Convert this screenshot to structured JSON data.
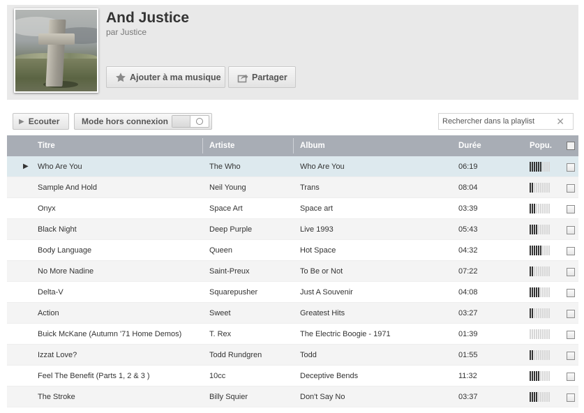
{
  "album": {
    "title": "And Justice",
    "artist": "par Justice",
    "add_label": "Ajouter à ma musique",
    "add_icon": "star-icon",
    "share_label": "Partager",
    "share_icon": "share-icon"
  },
  "toolbar": {
    "listen_label": "Ecouter",
    "offline_label": "Mode hors connexion",
    "offline_enabled": false,
    "search_placeholder": "Rechercher dans la playlist"
  },
  "table": {
    "columns": {
      "title": "Titre",
      "artist": "Artiste",
      "album": "Album",
      "duration": "Durée",
      "popularity": "Popu."
    },
    "popularity_max": 10,
    "rows": [
      {
        "title": "Who Are You",
        "artist": "The Who",
        "album": "Who Are You",
        "duration": "06:19",
        "popularity": 6,
        "playing": true
      },
      {
        "title": "Sample And Hold",
        "artist": "Neil Young",
        "album": "Trans",
        "duration": "08:04",
        "popularity": 2
      },
      {
        "title": "Onyx",
        "artist": "Space Art",
        "album": "Space art",
        "duration": "03:39",
        "popularity": 3
      },
      {
        "title": "Black Night",
        "artist": "Deep Purple",
        "album": "Live 1993",
        "duration": "05:43",
        "popularity": 4
      },
      {
        "title": "Body Language",
        "artist": "Queen",
        "album": "Hot Space",
        "duration": "04:32",
        "popularity": 6
      },
      {
        "title": "No More Nadine",
        "artist": "Saint-Preux",
        "album": "To Be or Not",
        "duration": "07:22",
        "popularity": 2
      },
      {
        "title": "Delta-V",
        "artist": "Squarepusher",
        "album": "Just A Souvenir",
        "duration": "04:08",
        "popularity": 5
      },
      {
        "title": "Action",
        "artist": "Sweet",
        "album": "Greatest Hits",
        "duration": "03:27",
        "popularity": 2
      },
      {
        "title": "Buick McKane (Autumn '71 Home Demos)",
        "artist": "T. Rex",
        "album": "The Electric Boogie - 1971",
        "duration": "01:39",
        "popularity": 0
      },
      {
        "title": "Izzat Love?",
        "artist": "Todd Rundgren",
        "album": "Todd",
        "duration": "01:55",
        "popularity": 2
      },
      {
        "title": "Feel The Benefit (Parts 1, 2 & 3 )",
        "artist": "10cc",
        "album": "Deceptive Bends",
        "duration": "11:32",
        "popularity": 5
      },
      {
        "title": "The Stroke",
        "artist": "Billy Squier",
        "album": "Don't Say No",
        "duration": "03:37",
        "popularity": 4
      }
    ]
  }
}
